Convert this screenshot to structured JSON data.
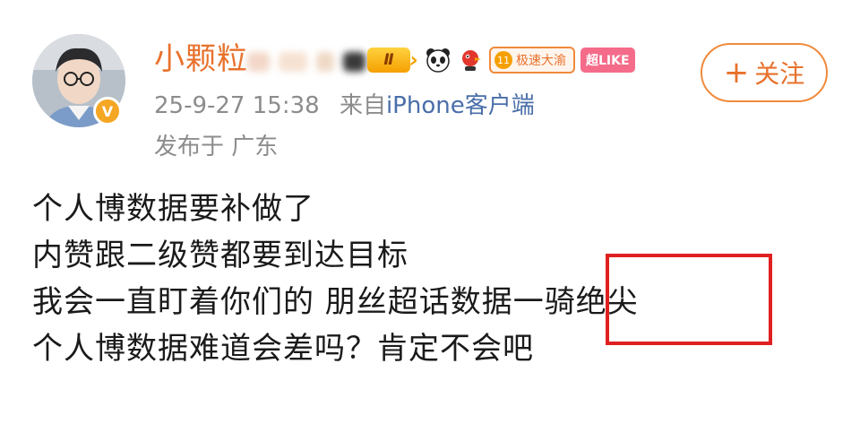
{
  "user": {
    "name": "小颗粒",
    "level_badge": "Ⅱ",
    "speed_badge_num": "11",
    "speed_badge_label": "极速大渝",
    "like_badge": "超LIKE",
    "verified_symbol": "V",
    "avatar_icon": "avatar-portrait",
    "panda_icon": "panda-icon",
    "mascot_icon": "bird-mascot-icon"
  },
  "follow": {
    "plus": "+",
    "label": "关注"
  },
  "post": {
    "time": "25-9-27 15:38",
    "source_prefix": "来自",
    "source": "iPhone客户端",
    "location": "发布于 广东",
    "lines": [
      "个人博数据要补做了",
      "内赞跟二级赞都要到达目标",
      "我会一直盯着你们的 朋丝超话数据一骑绝尖",
      "个人博数据难道会差吗？肯定不会吧"
    ]
  },
  "colors": {
    "accent": "#e8712c",
    "source_link": "#4a6ea9",
    "highlight_box": "#e02020"
  }
}
